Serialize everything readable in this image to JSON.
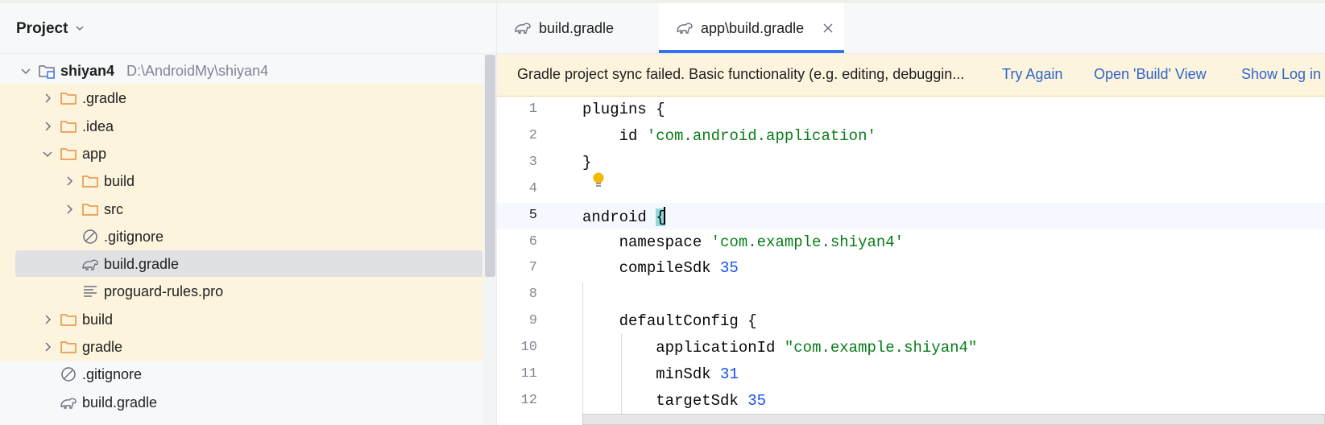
{
  "project_panel": {
    "title": "Project",
    "tree": [
      {
        "label": "shiyan4",
        "path": "D:\\AndroidMy\\shiyan4",
        "type": "module",
        "expanded": true
      },
      {
        "label": ".gradle",
        "type": "folder",
        "expanded": false
      },
      {
        "label": ".idea",
        "type": "folder",
        "expanded": false
      },
      {
        "label": "app",
        "type": "folder",
        "expanded": true
      },
      {
        "label": "build",
        "type": "folder",
        "expanded": false
      },
      {
        "label": "src",
        "type": "folder",
        "expanded": false
      },
      {
        "label": ".gitignore",
        "type": "ignore-file"
      },
      {
        "label": "build.gradle",
        "type": "gradle-file",
        "selected": true
      },
      {
        "label": "proguard-rules.pro",
        "type": "text-file"
      },
      {
        "label": "build",
        "type": "folder",
        "expanded": false
      },
      {
        "label": "gradle",
        "type": "folder",
        "expanded": false
      },
      {
        "label": ".gitignore",
        "type": "ignore-file"
      },
      {
        "label": "build.gradle",
        "type": "gradle-file"
      }
    ]
  },
  "editor": {
    "tabs": [
      {
        "label": "build.gradle",
        "active": false
      },
      {
        "label": "app\\build.gradle",
        "active": true
      }
    ],
    "banner": {
      "message": "Gradle project sync failed. Basic functionality (e.g. editing, debuggin...",
      "actions": [
        "Try Again",
        "Open 'Build' View",
        "Show Log in"
      ]
    },
    "code_lines": [
      {
        "n": "1",
        "indent": "",
        "parts": [
          [
            "kw",
            "plugins {"
          ]
        ]
      },
      {
        "n": "2",
        "indent": "    ",
        "parts": [
          [
            "kw",
            "id "
          ],
          [
            "str",
            "'com.android.application'"
          ]
        ]
      },
      {
        "n": "3",
        "indent": "",
        "parts": [
          [
            "kw",
            "}"
          ]
        ]
      },
      {
        "n": "4",
        "indent": "",
        "parts": []
      },
      {
        "n": "5",
        "indent": "",
        "parts": [
          [
            "kw",
            "android "
          ],
          [
            "brace",
            "{"
          ]
        ]
      },
      {
        "n": "6",
        "indent": "    ",
        "parts": [
          [
            "kw",
            "namespace "
          ],
          [
            "str",
            "'com.example.shiyan4'"
          ]
        ]
      },
      {
        "n": "7",
        "indent": "    ",
        "parts": [
          [
            "kw",
            "compileSdk "
          ],
          [
            "num",
            "35"
          ]
        ]
      },
      {
        "n": "8",
        "indent": "",
        "parts": []
      },
      {
        "n": "9",
        "indent": "    ",
        "parts": [
          [
            "kw",
            "defaultConfig {"
          ]
        ]
      },
      {
        "n": "10",
        "indent": "        ",
        "parts": [
          [
            "kw",
            "applicationId "
          ],
          [
            "str",
            "\"com.example.shiyan4\""
          ]
        ]
      },
      {
        "n": "11",
        "indent": "        ",
        "parts": [
          [
            "kw",
            "minSdk "
          ],
          [
            "num",
            "31"
          ]
        ]
      },
      {
        "n": "12",
        "indent": "        ",
        "parts": [
          [
            "kw",
            "targetSdk "
          ],
          [
            "num",
            "35"
          ]
        ]
      }
    ],
    "current_line": "5"
  },
  "colors": {
    "accent": "#3574f0",
    "banner_bg": "#fdf4de",
    "link": "#2f65ca",
    "string": "#067d17",
    "number": "#1750eb",
    "folder": "#e88d3c"
  }
}
